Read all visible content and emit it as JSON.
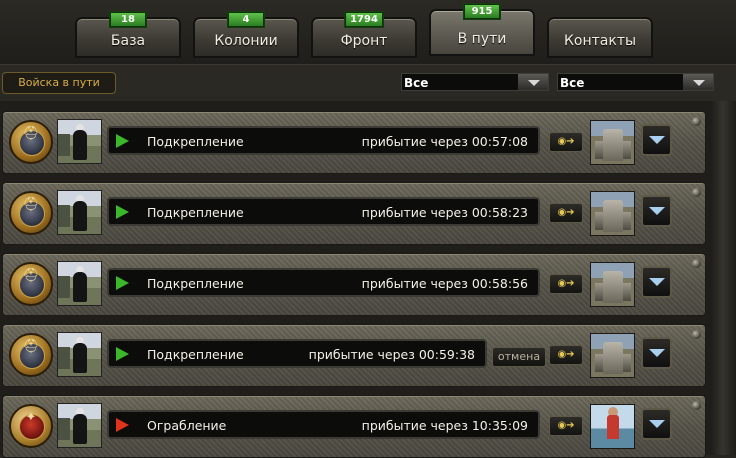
{
  "tabs": [
    {
      "label": "База",
      "count": "18",
      "active": false
    },
    {
      "label": "Колонии",
      "count": "4",
      "active": false
    },
    {
      "label": "Фронт",
      "count": "1794",
      "active": false
    },
    {
      "label": "В пути",
      "count": "915",
      "active": true
    },
    {
      "label": "Контакты",
      "count": "",
      "active": false
    }
  ],
  "filter": {
    "section_label": "Войска в пути",
    "select1": "Все",
    "select2": "Все"
  },
  "rows": [
    {
      "icon": "helmet-medal-icon",
      "type": "Подкрепление",
      "eta": "прибытие через 00:57:08",
      "cancel": "",
      "target_icon": "tower-building-icon",
      "status_color": "#3ab82a"
    },
    {
      "icon": "helmet-medal-icon",
      "type": "Подкрепление",
      "eta": "прибытие через 00:58:23",
      "cancel": "",
      "target_icon": "tower-building-icon",
      "status_color": "#3ab82a"
    },
    {
      "icon": "helmet-medal-icon",
      "type": "Подкрепление",
      "eta": "прибытие через 00:58:56",
      "cancel": "",
      "target_icon": "tower-building-icon",
      "status_color": "#3ab82a"
    },
    {
      "icon": "helmet-medal-icon",
      "type": "Подкрепление",
      "eta": "прибытие через 00:59:38",
      "cancel": "отмена",
      "target_icon": "tower-building-icon",
      "status_color": "#3ab82a"
    },
    {
      "icon": "pistol-medal-icon",
      "type": "Ограбление",
      "eta": "прибытие через 10:35:09",
      "cancel": "",
      "target_icon": "player-avatar-icon",
      "status_color": "#e0331c"
    }
  ]
}
